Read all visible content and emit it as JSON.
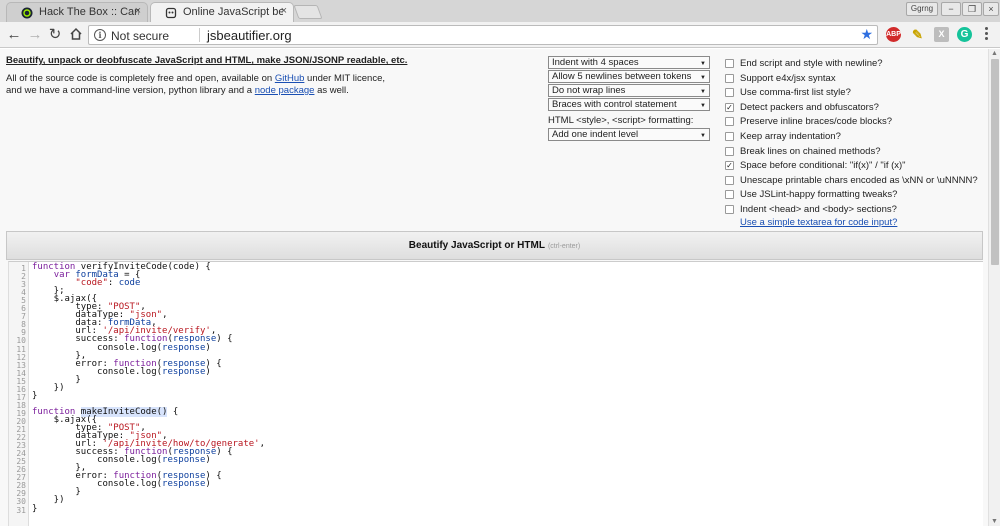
{
  "browser": {
    "tabs": [
      {
        "title": "Hack The Box :: Can you",
        "close": "×",
        "active": false
      },
      {
        "title": "Online JavaScript beauti",
        "close": "×",
        "active": true
      }
    ],
    "profile_label": "Ggrng",
    "window_minimize": "−",
    "window_restore": "❐",
    "window_close": "×",
    "address": {
      "security_label": "Not secure",
      "url": "jsbeautifier.org"
    },
    "extensions": [
      "ABP",
      "pencil",
      "X",
      "G"
    ],
    "colors": {
      "star": "#2f6fe0",
      "abp": "#d12b2b",
      "grammarly": "#15c39a"
    }
  },
  "intro": {
    "headline": "Beautify, unpack or deobfuscate JavaScript and HTML, make JSON/JSONP readable, etc.",
    "line1_prefix": "All of the source code is completely free and open, available on",
    "github_link": "GitHub",
    "line1_suffix": "under MIT licence,",
    "line2_prefix": "and we have a command-line version, python library and a",
    "node_link": "node package",
    "line2_suffix": "as well."
  },
  "selects": {
    "indent": "Indent with 4 spaces",
    "newlines": "Allow 5 newlines between tokens",
    "wrap": "Do not wrap lines",
    "braces": "Braces with control statement",
    "html_label": "HTML <style>, <script> formatting:",
    "html_indent": "Add one indent level"
  },
  "options": [
    {
      "label": "End script and style with newline?",
      "checked": false
    },
    {
      "label": "Support e4x/jsx syntax",
      "checked": false
    },
    {
      "label": "Use comma-first list style?",
      "checked": false
    },
    {
      "label": "Detect packers and obfuscators?",
      "checked": true
    },
    {
      "label": "Preserve inline braces/code blocks?",
      "checked": false
    },
    {
      "label": "Keep array indentation?",
      "checked": false
    },
    {
      "label": "Break lines on chained methods?",
      "checked": false
    },
    {
      "label": "Space before conditional: \"if(x)\" / \"if (x)\"",
      "checked": true
    },
    {
      "label": "Unescape printable chars encoded as \\xNN or \\uNNNN?",
      "checked": false
    },
    {
      "label": "Use JSLint-happy formatting tweaks?",
      "checked": false
    },
    {
      "label": "Indent <head> and <body> sections?",
      "checked": false
    }
  ],
  "textarea_link": "Use a simple textarea for code input?",
  "beautify_button": {
    "label": "Beautify JavaScript or HTML",
    "hint": "(ctrl-enter)"
  },
  "code_lines": [
    "function verifyInviteCode(code) {",
    "    var formData = {",
    "        \"code\": code",
    "    };",
    "    $.ajax({",
    "        type: \"POST\",",
    "        dataType: \"json\",",
    "        data: formData,",
    "        url: '/api/invite/verify',",
    "        success: function(response) {",
    "            console.log(response)",
    "        },",
    "        error: function(response) {",
    "            console.log(response)",
    "        }",
    "    })",
    "}",
    "",
    "function makeInviteCode() {",
    "    $.ajax({",
    "        type: \"POST\",",
    "        dataType: \"json\",",
    "        url: '/api/invite/how/to/generate',",
    "        success: function(response) {",
    "            console.log(response)",
    "        },",
    "        error: function(response) {",
    "            console.log(response)",
    "        }",
    "    })",
    "}"
  ]
}
